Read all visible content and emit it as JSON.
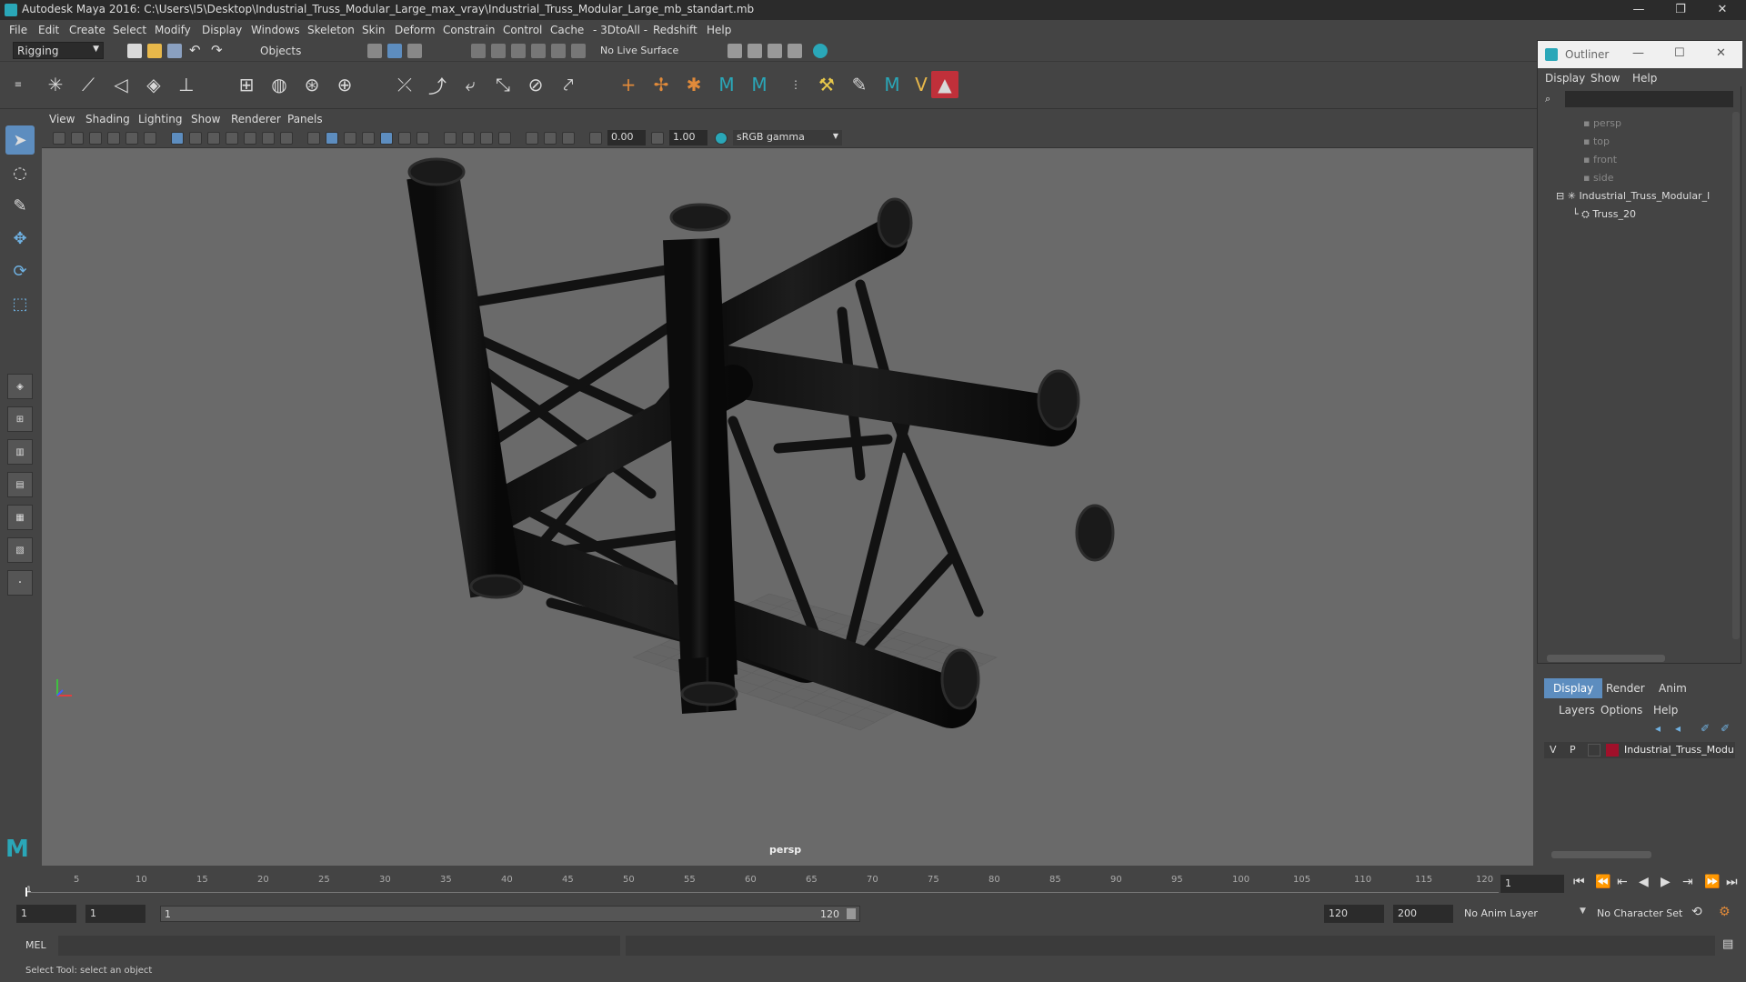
{
  "window": {
    "title": "Autodesk Maya 2016: C:\\Users\\I5\\Desktop\\Industrial_Truss_Modular_Large_max_vray\\Industrial_Truss_Modular_Large_mb_standart.mb",
    "minimize": "—",
    "maximize": "❐",
    "close": "✕"
  },
  "menubar": [
    "File",
    "Edit",
    "Create",
    "Select",
    "Modify",
    "Display",
    "Windows",
    "Skeleton",
    "Skin",
    "Deform",
    "Constrain",
    "Control",
    "Cache",
    "- 3DtoAll -",
    "Redshift",
    "Help"
  ],
  "statusline": {
    "menuset": "Rigging",
    "selection_mode": "Objects",
    "live_surface": "No Live Surface"
  },
  "panel": {
    "menus": [
      "View",
      "Shading",
      "Lighting",
      "Show",
      "Renderer",
      "Panels"
    ],
    "exposure": "0.00",
    "gamma": "1.00",
    "colorspace": "sRGB gamma",
    "camera_label": "persp"
  },
  "timeline": {
    "ticks": [
      "5",
      "10",
      "15",
      "20",
      "25",
      "30",
      "35",
      "40",
      "45",
      "50",
      "55",
      "60",
      "65",
      "70",
      "75",
      "80",
      "85",
      "90",
      "95",
      "100",
      "105",
      "110",
      "115",
      "120"
    ],
    "start_marker": "1",
    "current_frame": "1"
  },
  "range": {
    "start": "1",
    "playback_start": "1",
    "slider_start": "1",
    "slider_end": "120",
    "playback_end": "120",
    "end": "200",
    "anim_layer": "No Anim Layer",
    "character_set": "No Character Set"
  },
  "cmdline": {
    "label": "MEL"
  },
  "helpline": {
    "text": "Select Tool: select an object"
  },
  "outliner": {
    "title": "Outliner",
    "menus": [
      "Display",
      "Show",
      "Help"
    ],
    "items": [
      "persp",
      "top",
      "front",
      "side",
      "Industrial_Truss_Modular_l",
      "Truss_20"
    ]
  },
  "layers": {
    "tabs": [
      "Display",
      "Render",
      "Anim"
    ],
    "menus": [
      "Layers",
      "Options",
      "Help"
    ],
    "row": {
      "v": "V",
      "p": "P",
      "name": "Industrial_Truss_Modu",
      "color": "#a0102a"
    }
  },
  "colors": {
    "accent": "#5d8dbf",
    "viewport_bg": "#6a6a6a",
    "ui_bg": "#444444"
  }
}
